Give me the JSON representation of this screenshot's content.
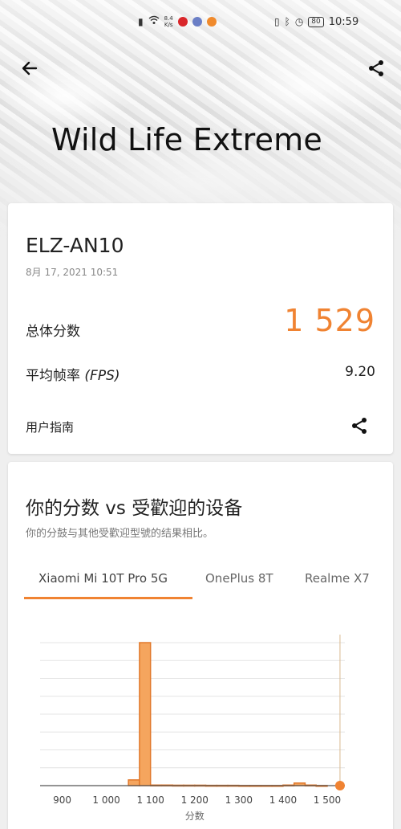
{
  "status_bar": {
    "net_speed_top": "8.4",
    "net_speed_bottom": "K/s",
    "battery": "80",
    "time": "10:59"
  },
  "header": {
    "back_icon": "back-arrow-icon",
    "share_icon": "share-icon",
    "title": "Wild Life Extreme"
  },
  "result": {
    "device": "ELZ-AN10",
    "date": "8月 17, 2021 10:51",
    "score_label": "总体分数",
    "score_value": "1 529",
    "fps_label_cn": "平均帧率",
    "fps_label_en": "(FPS)",
    "fps_value": "9.20",
    "guide_label": "用户指南",
    "share_icon": "share-icon"
  },
  "comparison": {
    "title": "你的分数 vs 受歡迎的设备",
    "subtitle": "你的分鼓与其他受歡迎型號的结果相比。",
    "tabs": [
      {
        "label": "Xiaomi Mi 10T Pro 5G",
        "active": true
      },
      {
        "label": "OnePlus 8T",
        "active": false
      },
      {
        "label": "Realme X7",
        "active": false
      }
    ]
  },
  "colors": {
    "accent": "#f08332",
    "bar_fill": "#f5a55e",
    "bar_stroke": "#e2782a"
  },
  "chart_data": {
    "type": "bar",
    "xlabel": "分数",
    "x_ticks": [
      "900",
      "1 000",
      "1 100",
      "1 200",
      "1 300",
      "1 400",
      "1 500"
    ],
    "bins": [
      {
        "from": 1050,
        "to": 1075,
        "value": 4
      },
      {
        "from": 1075,
        "to": 1100,
        "value": 100
      },
      {
        "from": 1100,
        "to": 1125,
        "value": 0.4
      },
      {
        "from": 1125,
        "to": 1150,
        "value": 0.4
      },
      {
        "from": 1150,
        "to": 1175,
        "value": 0.3
      },
      {
        "from": 1175,
        "to": 1200,
        "value": 0.3
      },
      {
        "from": 1200,
        "to": 1225,
        "value": 0.3
      },
      {
        "from": 1225,
        "to": 1250,
        "value": 0.2
      },
      {
        "from": 1250,
        "to": 1275,
        "value": 0.2
      },
      {
        "from": 1275,
        "to": 1300,
        "value": 0.2
      },
      {
        "from": 1300,
        "to": 1325,
        "value": 0.1
      },
      {
        "from": 1325,
        "to": 1350,
        "value": 0.1
      },
      {
        "from": 1350,
        "to": 1375,
        "value": 0.1
      },
      {
        "from": 1375,
        "to": 1400,
        "value": 0.1
      },
      {
        "from": 1400,
        "to": 1425,
        "value": 0.4
      },
      {
        "from": 1425,
        "to": 1450,
        "value": 1.8
      },
      {
        "from": 1450,
        "to": 1475,
        "value": 0.4
      },
      {
        "from": 1475,
        "to": 1500,
        "value": 0.1
      }
    ],
    "your_score": 1529,
    "xlim": [
      850,
      1540
    ],
    "ylim": [
      0,
      100
    ],
    "grid": true
  }
}
